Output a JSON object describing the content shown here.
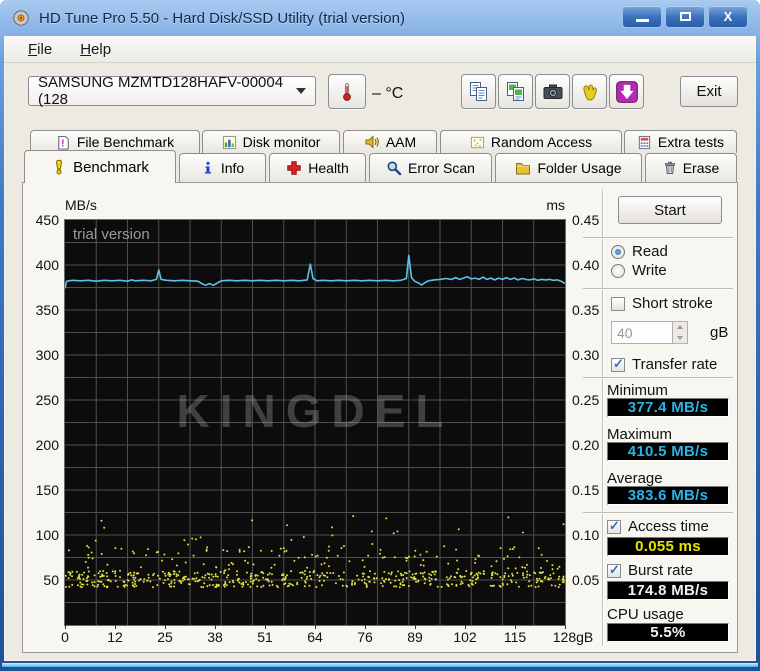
{
  "window": {
    "title": "HD Tune Pro 5.50 - Hard Disk/SSD Utility (trial version)",
    "close_glyph": "X"
  },
  "menu": {
    "items": [
      {
        "label": "File"
      },
      {
        "label": "Help"
      }
    ]
  },
  "toolbar": {
    "drive_select": {
      "value": "SAMSUNG MZMTD128HAFV-00004 (128"
    },
    "temperature": {
      "value": "–",
      "unit": "°C",
      "display": "– °C"
    },
    "buttons": [
      {
        "icon": "copy-text-icon"
      },
      {
        "icon": "copy-image-icon"
      },
      {
        "icon": "camera-icon"
      },
      {
        "icon": "hand-icon"
      },
      {
        "icon": "download-arrow-icon"
      }
    ],
    "exit_label": "Exit"
  },
  "tabs": {
    "row1": [
      {
        "label": "File Benchmark",
        "icon": "file-benchmark-icon"
      },
      {
        "label": "Disk monitor",
        "icon": "disk-monitor-icon"
      },
      {
        "label": "AAM",
        "icon": "speaker-icon"
      },
      {
        "label": "Random Access",
        "icon": "random-access-icon"
      },
      {
        "label": "Extra tests",
        "icon": "extra-tests-icon"
      }
    ],
    "row2": [
      {
        "label": "Benchmark",
        "icon": "benchmark-exclamation-icon",
        "active": true
      },
      {
        "label": "Info",
        "icon": "info-icon"
      },
      {
        "label": "Health",
        "icon": "health-cross-icon"
      },
      {
        "label": "Error Scan",
        "icon": "magnifier-icon"
      },
      {
        "label": "Folder Usage",
        "icon": "folder-icon"
      },
      {
        "label": "Erase",
        "icon": "trash-icon"
      }
    ],
    "active_tab": "Benchmark"
  },
  "benchmark_panel": {
    "start_label": "Start",
    "read_label": "Read",
    "write_label": "Write",
    "read_selected": true,
    "write_selected": false,
    "short_stroke_label": "Short stroke",
    "short_stroke_checked": false,
    "short_stroke_value": "40",
    "short_stroke_unit": "gB",
    "transfer_rate_label": "Transfer rate",
    "transfer_rate_checked": true,
    "minimum_label": "Minimum",
    "minimum_value": "377.4 MB/s",
    "maximum_label": "Maximum",
    "maximum_value": "410.5 MB/s",
    "average_label": "Average",
    "average_value": "383.6 MB/s",
    "access_time_label": "Access time",
    "access_time_checked": true,
    "access_time_value": "0.055 ms",
    "burst_rate_label": "Burst rate",
    "burst_rate_checked": true,
    "burst_rate_value": "174.8 MB/s",
    "cpu_usage_label": "CPU usage",
    "cpu_usage_value": "5.5%",
    "lcd_colors": {
      "rate": "#27b4e8",
      "access": "#e8e400",
      "plain": "#f2f2f2"
    }
  },
  "chart_data": {
    "type": "line+scatter",
    "left_axis": {
      "label": "MB/s",
      "min": 0,
      "max": 450,
      "ticks": [
        "450",
        "400",
        "350",
        "300",
        "250",
        "200",
        "150",
        "100",
        "50"
      ]
    },
    "right_axis": {
      "label": "ms",
      "min": 0,
      "max": 0.45,
      "ticks": [
        "0.45",
        "0.40",
        "0.35",
        "0.30",
        "0.25",
        "0.20",
        "0.15",
        "0.10",
        "0.05"
      ]
    },
    "x_axis": {
      "min": 0,
      "max": 128,
      "ticks": [
        "0",
        "12",
        "25",
        "38",
        "51",
        "64",
        "76",
        "89",
        "102",
        "115",
        "128gB"
      ]
    },
    "grid": {
      "x_divisions": 16,
      "y_divisions": 18,
      "color": "#4f4f4f",
      "background": "#0c0c0c"
    },
    "watermarks": {
      "corner": "trial version",
      "center": "KINGDEL"
    },
    "series": [
      {
        "name": "Transfer rate",
        "type": "line",
        "color": "#5ec1ea",
        "unit": "MB/s",
        "points": [
          [
            0,
            374
          ],
          [
            0.4,
            382
          ],
          [
            2,
            383
          ],
          [
            4,
            382.5
          ],
          [
            6,
            383
          ],
          [
            8,
            382
          ],
          [
            10,
            383
          ],
          [
            12,
            382.5
          ],
          [
            14,
            383
          ],
          [
            16,
            382
          ],
          [
            17,
            383.5
          ],
          [
            18,
            382.5
          ],
          [
            20,
            383
          ],
          [
            22,
            382.5
          ],
          [
            23.4,
            384
          ],
          [
            24,
            394.5
          ],
          [
            24.6,
            384
          ],
          [
            26,
            383
          ],
          [
            28,
            382.5
          ],
          [
            30,
            383
          ],
          [
            32,
            382.5
          ],
          [
            34,
            382
          ],
          [
            35,
            379.5
          ],
          [
            36,
            377.5
          ],
          [
            37,
            379.5
          ],
          [
            38,
            377.5
          ],
          [
            39,
            380
          ],
          [
            40,
            382.5
          ],
          [
            42,
            383
          ],
          [
            44,
            382.5
          ],
          [
            46,
            383
          ],
          [
            48,
            382.5
          ],
          [
            50,
            383
          ],
          [
            52,
            382.5
          ],
          [
            54,
            383
          ],
          [
            56,
            382.5
          ],
          [
            58,
            383
          ],
          [
            60,
            382.5
          ],
          [
            62,
            383.5
          ],
          [
            62.8,
            401
          ],
          [
            63.5,
            385
          ],
          [
            64.5,
            382.5
          ],
          [
            66,
            383
          ],
          [
            68,
            382.5
          ],
          [
            70,
            383
          ],
          [
            72,
            382.5
          ],
          [
            74,
            383
          ],
          [
            76,
            382.5
          ],
          [
            78,
            383
          ],
          [
            80,
            382.5
          ],
          [
            82,
            383
          ],
          [
            84,
            382.5
          ],
          [
            86,
            383
          ],
          [
            87.4,
            385
          ],
          [
            88,
            410.5
          ],
          [
            88.7,
            386
          ],
          [
            89.5,
            382
          ],
          [
            90.5,
            380
          ],
          [
            91.3,
            377.8
          ],
          [
            92,
            380
          ],
          [
            93,
            382.5
          ],
          [
            94.5,
            383.5
          ],
          [
            96,
            384
          ],
          [
            97.5,
            385
          ],
          [
            99,
            384
          ],
          [
            100,
            386
          ],
          [
            101,
            384
          ],
          [
            102,
            385.5
          ],
          [
            103,
            387
          ],
          [
            104,
            384.5
          ],
          [
            105,
            385.5
          ],
          [
            106,
            384
          ],
          [
            107,
            386.5
          ],
          [
            108,
            384
          ],
          [
            109,
            385.5
          ],
          [
            110,
            383.5
          ],
          [
            111,
            385.5
          ],
          [
            112,
            384
          ],
          [
            113,
            386
          ],
          [
            114,
            384
          ],
          [
            115,
            385.5
          ],
          [
            116,
            383.5
          ],
          [
            117,
            385
          ],
          [
            118,
            384
          ],
          [
            119,
            383.5
          ],
          [
            120,
            384.5
          ],
          [
            121,
            383
          ],
          [
            122,
            384
          ],
          [
            123,
            383.5
          ],
          [
            124,
            384
          ],
          [
            125,
            383
          ],
          [
            126,
            383.5
          ],
          [
            127,
            382
          ],
          [
            128,
            379.5
          ]
        ]
      },
      {
        "name": "Access time",
        "type": "scatter",
        "color": "#e0e040",
        "unit": "ms",
        "count": 680,
        "seed": 12,
        "distribution": {
          "cluster_ms": [
            0.042,
            0.06
          ],
          "spread_ms": [
            0.055,
            0.088
          ],
          "outlier_ms": [
            0.088,
            0.122
          ]
        },
        "typical_ms": 0.055
      }
    ]
  }
}
